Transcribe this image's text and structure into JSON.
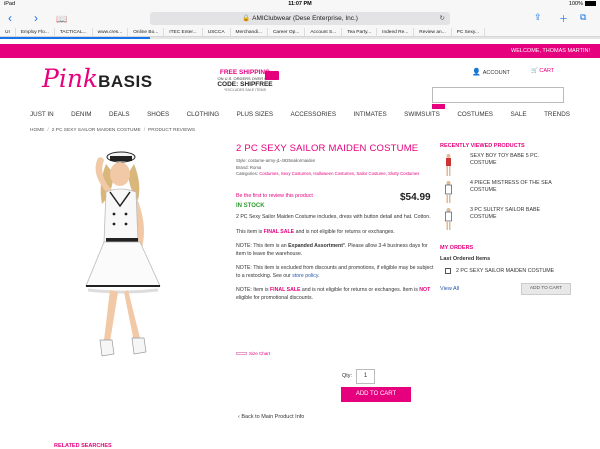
{
  "status": {
    "carrier": "iPad",
    "time": "11:07 PM",
    "battery": "100%"
  },
  "browser": {
    "address": "AMIClubwear (Dese Enterprise, Inc.)",
    "progress": 0.25,
    "bookmarks": [
      "UI",
      "Employ Flo...",
      "TACTICAL...",
      "www.cres...",
      "Online Bo...",
      "ITEC Enter...",
      "USCCA",
      "Merchandi...",
      "Career Op...",
      "Account S...",
      "Tea Party...",
      "Indeed Re...",
      "Review an...",
      "PC Sexy..."
    ]
  },
  "site": {
    "welcome": "WELCOME, THOMAS MARTIN!",
    "logo_pink": "Pink",
    "logo_basis": "BASIS",
    "shipping": {
      "line1": "FREE SHIPPING",
      "line2": "ON U.S. ORDERS OVER $59*",
      "line3": "CODE: SHIPFREE",
      "line4": "*EXCLUDES SALE ITEMS"
    },
    "account": "ACCOUNT",
    "cart": "CART",
    "nav": [
      "JUST IN",
      "DENIM",
      "DEALS",
      "SHOES",
      "CLOTHING",
      "PLUS SIZES",
      "ACCESSORIES",
      "INTIMATES",
      "SWIMSUITS",
      "COSTUMES",
      "SALE",
      "TRENDS"
    ],
    "breadcrumb": [
      "HOME",
      "2 PC SEXY SAILOR MAIDEN COSTUME",
      "PRODUCT REVIEWS"
    ]
  },
  "product": {
    "title": "2 PC SEXY SAILOR MAIDEN COSTUME",
    "style": "Style: costume-army-j1-4925sailormaiden",
    "brand": "Brand: Roma",
    "categories_label": "Categories:",
    "categories": "Costumes, Sexy Costumes, Halloween Costumes, Sailor Costume, Slutty Costumes",
    "review_link": "Be the first to review this product",
    "price": "$54.99",
    "stock": "IN STOCK",
    "description": "2 PC Sexy Sailor Maiden Costume includes, dress with button detail and hat. Cotton.",
    "final_sale_1a": "This item is ",
    "final_sale_1b": "FINAL SALE",
    "final_sale_1c": " and is not eligible for returns or exchanges.",
    "note_1a": "NOTE: This item is an ",
    "note_1b": "Expanded Assortment",
    "note_1c": "*. Please allow 3-4 business days for item to leave the warehouse.",
    "note_2a": "NOTE: This item is excluded from discounts and promotions, if eligible may be subject to a restocking. See our ",
    "note_2b": "store policy",
    "note_2c": ".",
    "note_3a": "NOTE: Item is ",
    "note_3b": "FINAL SALE",
    "note_3c": " and is not eligible for returns or exchanges. Item is ",
    "note_3d": "NOT",
    "note_3e": " eligible for promotional discounts.",
    "size_chart": "Size Chart",
    "qty_label": "Qty:",
    "qty": "1",
    "add_to_cart": "ADD TO CART",
    "back": "‹ Back to Main Product Info",
    "related": "RELATED SEARCHES"
  },
  "sidebar": {
    "recent_heading": "RECENTLY VIEWED PRODUCTS",
    "recent": [
      {
        "name": "SEXY BOY TOY BABE 5 PC. COSTUME"
      },
      {
        "name": "4 PIECE MISTRESS OF THE SEA COSTUME"
      },
      {
        "name": "3 PC SULTRY SAILOR BABE COSTUME"
      }
    ],
    "orders_heading": "MY ORDERS",
    "orders_sub": "Last Ordered Items",
    "order_item": "2 PC SEXY SAILOR MAIDEN COSTUME",
    "view_all": "View All",
    "add_to_cart": "ADD TO CART"
  },
  "colors": {
    "brand": "#e6007e",
    "stock": "#2e9b2e",
    "link": "#2857a8",
    "ios": "#1a73e8"
  }
}
